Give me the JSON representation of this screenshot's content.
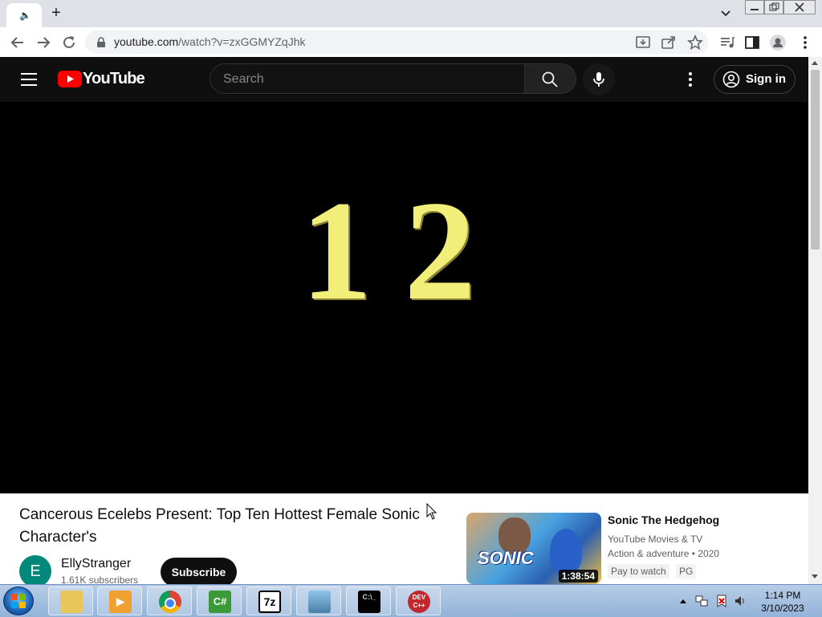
{
  "browser": {
    "new_tab_label": "+",
    "url_host": "youtube.com",
    "url_path": "/watch?v=zxGGMYZqJhk"
  },
  "youtube": {
    "logo_text": "YouTube",
    "search_placeholder": "Search",
    "sign_in_label": "Sign in"
  },
  "video": {
    "frame_text": "12"
  },
  "info": {
    "title": "Cancerous Ecelebs Present: Top Ten Hottest Female Sonic Character's",
    "channel_initial": "E",
    "channel_name": "EllyStranger",
    "subscribers": "1.61K subscribers",
    "subscribe_label": "Subscribe"
  },
  "recommended": {
    "title": "Sonic The Hedgehog",
    "channel": "YouTube Movies & TV",
    "meta": "Action & adventure • 2020",
    "badge_pay": "Pay to watch",
    "badge_rating": "PG",
    "duration": "1:38:54",
    "thumb_text": "SONIC"
  },
  "taskbar": {
    "time": "1:14 PM",
    "date": "3/10/2023",
    "apps": [
      {
        "icon": "folder-icon",
        "label": ""
      },
      {
        "icon": "media-player-icon",
        "label": ""
      },
      {
        "icon": "chrome-icon",
        "label": ""
      },
      {
        "icon": "csharp-icon",
        "label": "C#"
      },
      {
        "icon": "7zip-icon",
        "label": "7z"
      },
      {
        "icon": "image-viewer-icon",
        "label": ""
      },
      {
        "icon": "console-icon",
        "label": "C:\\_"
      },
      {
        "icon": "devcpp-icon",
        "label": "DEV C++"
      }
    ]
  }
}
